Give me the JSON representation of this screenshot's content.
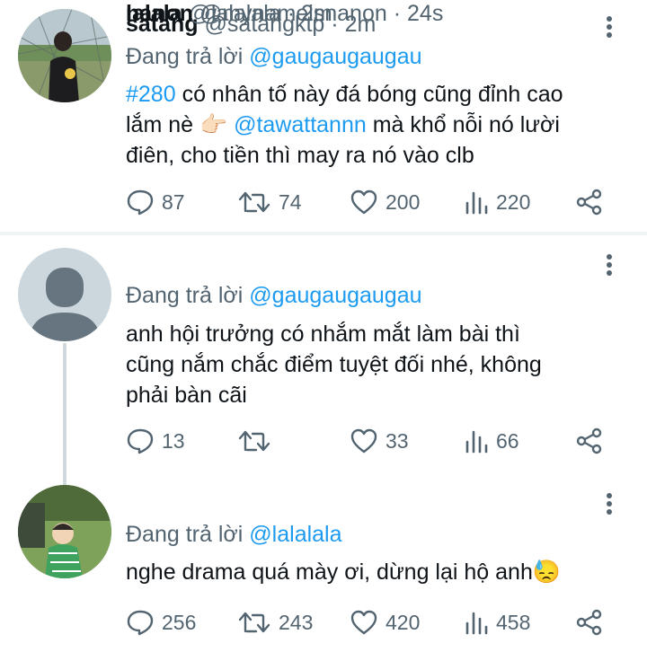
{
  "tweets": [
    {
      "name": "satang",
      "handle": "@satangktp",
      "separator": "·",
      "time": "2m",
      "replying_prefix": "Đang trả lời",
      "replying_to": "@gaugaugaugau",
      "body": {
        "line1_tag": "#280",
        "line1_rest": " có nhân tố này đá bóng cũng đỉnh cao",
        "line2_start": "lắm nè ",
        "line2_emoji": "👉🏻",
        "line2_mention": "@tawattannn",
        "line2_rest": " mà khổ nỗi nó lười",
        "line3": "điên, cho tiền thì may ra nó vào clb"
      },
      "replies": "87",
      "retweets": "74",
      "likes": "200",
      "views": "220"
    },
    {
      "name": "lalala",
      "handle": "@lalalala",
      "separator": "·",
      "time": "2m",
      "replying_prefix": "Đang trả lời",
      "replying_to": "@gaugaugaugau",
      "body": {
        "line1": "anh hội trưởng có nhắm mắt làm bài thì",
        "line2": "cũng nắm chắc điểm tuyệt đối nhé, không",
        "line3": "phải bàn cãi"
      },
      "replies": "13",
      "retweets": "",
      "likes": "33",
      "views": "66"
    },
    {
      "name": "nanon",
      "handle": "@mynameisnanon",
      "separator": "·",
      "time": "24s",
      "replying_prefix": "Đang trả lời",
      "replying_to": "@lalalala",
      "body": {
        "line1": "nghe drama quá mày ơi, dừng lại hộ anh",
        "line1_emoji": "😓"
      },
      "replies": "256",
      "retweets": "243",
      "likes": "420",
      "views": "458"
    }
  ],
  "icons": {
    "reply": "reply-icon",
    "retweet": "retweet-icon",
    "like": "heart-icon",
    "views": "views-icon",
    "share": "share-icon",
    "more": "more-vertical-icon"
  },
  "colors": {
    "text": "#0f1419",
    "secondary": "#536471",
    "link": "#1d9bf0",
    "divider": "#eff3f4",
    "thread_line": "#cfd9de"
  }
}
